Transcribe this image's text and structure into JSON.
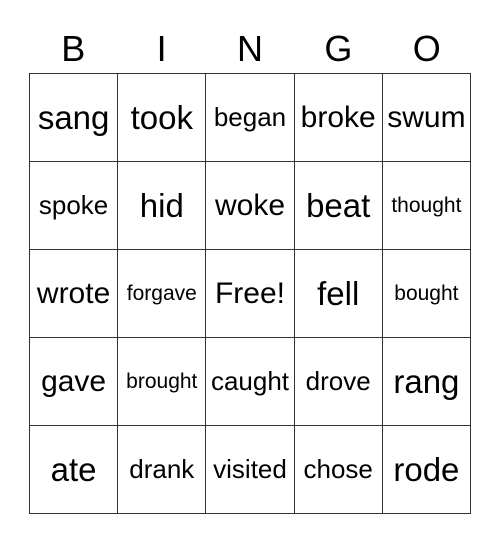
{
  "header": [
    "B",
    "I",
    "N",
    "G",
    "O"
  ],
  "cells": [
    [
      {
        "text": "sang",
        "size": "s1"
      },
      {
        "text": "took",
        "size": "s1"
      },
      {
        "text": "began",
        "size": "s3"
      },
      {
        "text": "broke",
        "size": "s2"
      },
      {
        "text": "swum",
        "size": "s2"
      }
    ],
    [
      {
        "text": "spoke",
        "size": "s3"
      },
      {
        "text": "hid",
        "size": "s1"
      },
      {
        "text": "woke",
        "size": "s2"
      },
      {
        "text": "beat",
        "size": "s1"
      },
      {
        "text": "thought",
        "size": "s4"
      }
    ],
    [
      {
        "text": "wrote",
        "size": "s2"
      },
      {
        "text": "forgave",
        "size": "s4"
      },
      {
        "text": "Free!",
        "size": "s2"
      },
      {
        "text": "fell",
        "size": "s1"
      },
      {
        "text": "bought",
        "size": "s4"
      }
    ],
    [
      {
        "text": "gave",
        "size": "s2"
      },
      {
        "text": "brought",
        "size": "s4"
      },
      {
        "text": "caught",
        "size": "s3"
      },
      {
        "text": "drove",
        "size": "s3"
      },
      {
        "text": "rang",
        "size": "s1"
      }
    ],
    [
      {
        "text": "ate",
        "size": "s1"
      },
      {
        "text": "drank",
        "size": "s3"
      },
      {
        "text": "visited",
        "size": "s3"
      },
      {
        "text": "chose",
        "size": "s3"
      },
      {
        "text": "rode",
        "size": "s1"
      }
    ]
  ]
}
